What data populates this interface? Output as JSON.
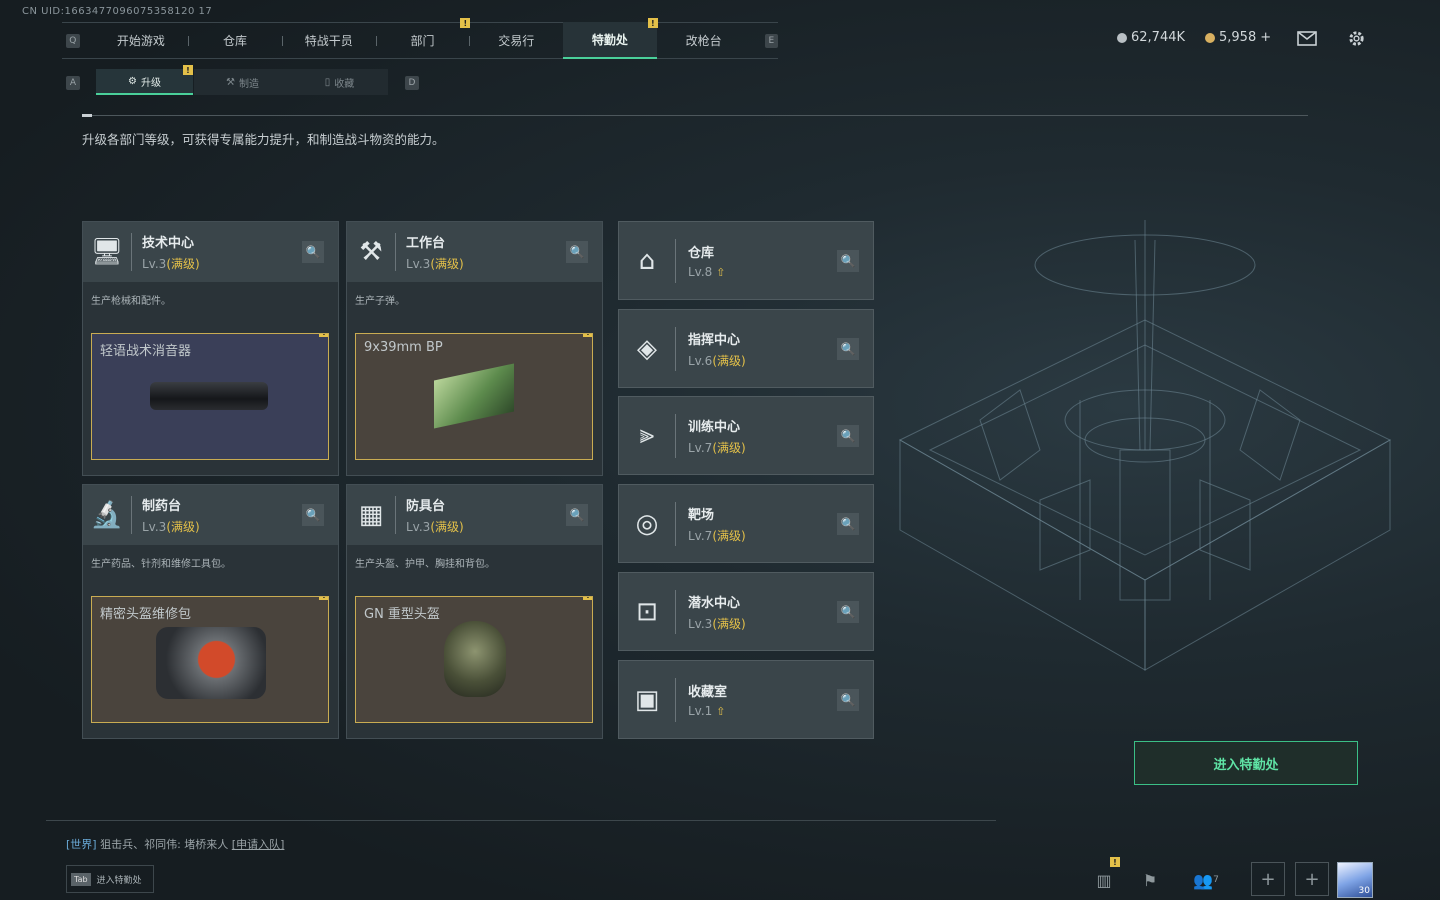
{
  "header": {
    "uid": "CN UID:1663477096075358120 17",
    "currency1": "62,744K",
    "currency2": "5,958"
  },
  "nav": {
    "prev_key": "Q",
    "next_key": "E",
    "badge": "!",
    "tabs": [
      "开始游戏",
      "仓库",
      "特战干员",
      "部门",
      "交易行",
      "特勤处",
      "改枪台"
    ],
    "active": "特勤处"
  },
  "subnav": {
    "prev_key": "A",
    "next_key": "D",
    "tabs": [
      "升级",
      "制造",
      "收藏"
    ],
    "active": "升级"
  },
  "page": {
    "description": "升级各部门等级，可获得专属能力提升，和制造战斗物资的能力。",
    "enter_button": "进入特勤处"
  },
  "workstations": [
    {
      "name": "技术中心",
      "level": "Lv.3",
      "status": "(满级)",
      "desc": "生产枪械和配件。",
      "item": "轻语战术消音器"
    },
    {
      "name": "工作台",
      "level": "Lv.3",
      "status": "(满级)",
      "desc": "生产子弹。",
      "item": "9x39mm BP"
    },
    {
      "name": "制药台",
      "level": "Lv.3",
      "status": "(满级)",
      "desc": "生产药品、针剂和维修工具包。",
      "item": "精密头盔维修包"
    },
    {
      "name": "防具台",
      "level": "Lv.3",
      "status": "(满级)",
      "desc": "生产头盔、护甲、胸挂和背包。",
      "item": "GN 重型头盔"
    }
  ],
  "facilities": [
    {
      "name": "仓库",
      "level": "Lv.8",
      "status": ""
    },
    {
      "name": "指挥中心",
      "level": "Lv.6",
      "status": "(满级)"
    },
    {
      "name": "训练中心",
      "level": "Lv.7",
      "status": "(满级)"
    },
    {
      "name": "靶场",
      "level": "Lv.7",
      "status": "(满级)"
    },
    {
      "name": "潜水中心",
      "level": "Lv.3",
      "status": "(满级)"
    },
    {
      "name": "收藏室",
      "level": "Lv.1",
      "status": ""
    }
  ],
  "chat": {
    "channel": "[世界]",
    "text": "狙击兵、祁同伟: 堵桥来人",
    "link": "[申请入队]"
  },
  "footer": {
    "key": "Tab",
    "label": "进入特勤处",
    "friends_count": "7",
    "avatar_level": "30"
  },
  "colors": {
    "accent_green": "#4ad09a",
    "max_level_gold": "#e3c049",
    "alert_badge": "#e3c049"
  }
}
